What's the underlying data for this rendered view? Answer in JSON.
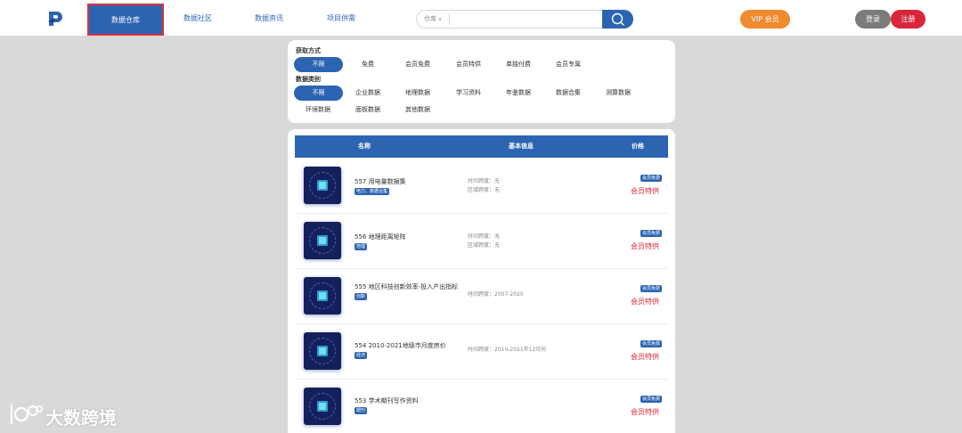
{
  "nav": {
    "items": [
      {
        "label": "数据仓库",
        "active": true
      },
      {
        "label": "数据社区",
        "active": false
      },
      {
        "label": "数据资讯",
        "active": false
      },
      {
        "label": "项目供需",
        "active": false
      }
    ]
  },
  "search": {
    "scope_label": "仓库",
    "value": "",
    "placeholder": "",
    "button_icon": "search-icon"
  },
  "header_buttons": {
    "vip": "VIP 会员",
    "login": "登录",
    "register": "注册"
  },
  "filters": {
    "acquire_title": "获取方式",
    "acquire_options": [
      "不限",
      "免费",
      "会员免费",
      "会员特供",
      "单独付费",
      "会员专属"
    ],
    "acquire_selected": "不限",
    "category_title": "数据类别",
    "category_options_row1": [
      "不限",
      "企业数据",
      "地理数据",
      "学习资料",
      "年鉴数据",
      "数据合集",
      "测算数据"
    ],
    "category_options_row2": [
      "环境数据",
      "面板数据",
      "其他数据"
    ],
    "category_selected": "不限"
  },
  "table": {
    "headers": {
      "name": "名称",
      "info": "基本信息",
      "price": "价格"
    },
    "rows": [
      {
        "name": "557 用电量数据集",
        "tag": "电力、数据合集",
        "info": [
          "时间跨度：无",
          "区域跨度：无"
        ],
        "badge": "会员免费",
        "price": "会员特供"
      },
      {
        "name": "556 地理距离矩阵",
        "tag": "地理",
        "info": [
          "时间跨度：无",
          "区域跨度：无"
        ],
        "badge": "会员免费",
        "price": "会员特供"
      },
      {
        "name": "555 地区科技创新效率-投入产出指标",
        "tag": "创新",
        "info": [
          "时间跨度：2007-2020"
        ],
        "badge": "会员免费",
        "price": "会员特供"
      },
      {
        "name": "554 2010-2021地级市月度房价",
        "tag": "经济",
        "info": [
          "时间跨度：2010-2021年12月份"
        ],
        "badge": "会员免费",
        "price": "会员特供"
      },
      {
        "name": "553 学术期刊写作资料",
        "tag": "期刊",
        "info": [],
        "badge": "会员免费",
        "price": "会员特供"
      }
    ]
  },
  "watermark": {
    "text": "大数跨境"
  },
  "colors": {
    "brand_blue": "#2c64b2",
    "vip_orange": "#f08a2e",
    "register_red": "#d9263a",
    "login_gray": "#7b7b7b",
    "price_red": "#d9263a"
  }
}
